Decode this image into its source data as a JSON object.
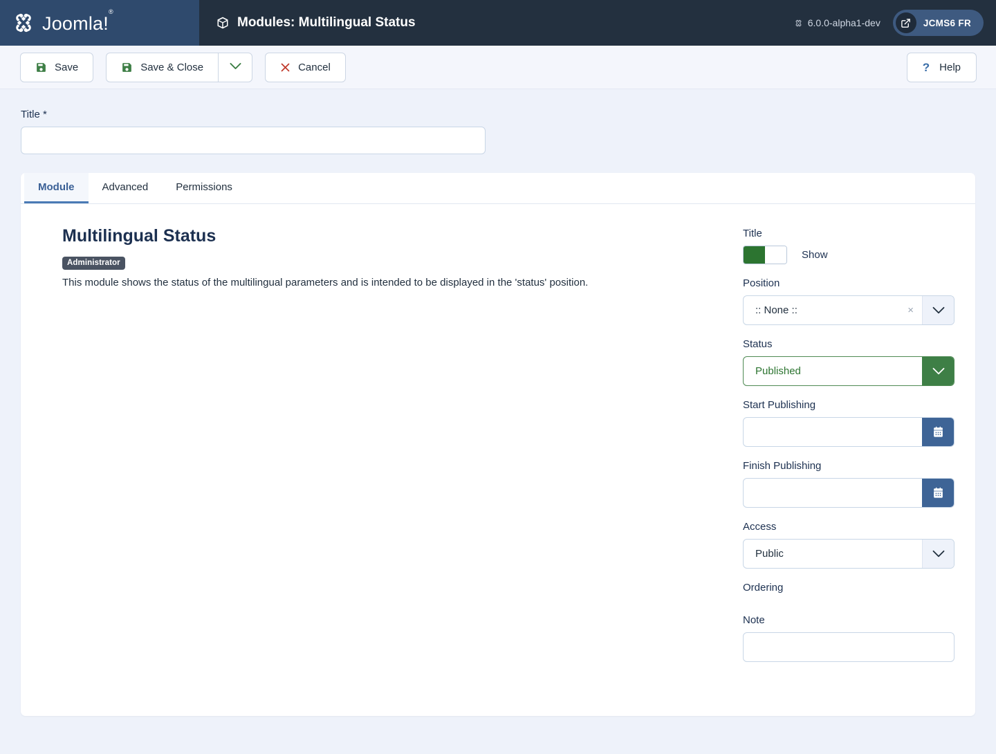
{
  "header": {
    "brand": "Joomla!",
    "brand_icon": "joomla-logo-icon",
    "title": "Modules: Multilingual Status",
    "title_icon": "cube-icon",
    "version": "6.0.0-alpha1-dev",
    "version_icon": "joomla-mark-icon",
    "site_button": "JCMS6 FR",
    "site_button_icon": "external-link-icon"
  },
  "toolbar": {
    "save_label": "Save",
    "save_icon": "floppy-disk-icon",
    "save_close_label": "Save & Close",
    "save_close_icon": "floppy-disk-icon",
    "save_dropdown_icon": "chevron-down-icon",
    "cancel_label": "Cancel",
    "cancel_icon": "close-x-icon",
    "help_label": "Help",
    "help_icon": "question-mark-icon"
  },
  "title_field": {
    "label": "Title *",
    "value": "",
    "placeholder": ""
  },
  "tabs": [
    {
      "label": "Module",
      "active": true
    },
    {
      "label": "Advanced",
      "active": false
    },
    {
      "label": "Permissions",
      "active": false
    }
  ],
  "module": {
    "heading": "Multilingual Status",
    "badge": "Administrator",
    "description": "This module shows the status of the multilingual parameters and is intended to be displayed in the 'status' position."
  },
  "sidebar": {
    "title": {
      "label": "Title",
      "toggle_state": "Show",
      "toggle_on": true
    },
    "position": {
      "label": "Position",
      "value": ":: None ::",
      "clear_icon": "close-x-icon",
      "caret_icon": "chevron-down-icon"
    },
    "status": {
      "label": "Status",
      "value": "Published",
      "caret_icon": "chevron-down-icon"
    },
    "start_publishing": {
      "label": "Start Publishing",
      "value": "",
      "calendar_icon": "calendar-icon"
    },
    "finish_publishing": {
      "label": "Finish Publishing",
      "value": "",
      "calendar_icon": "calendar-icon"
    },
    "access": {
      "label": "Access",
      "value": "Public",
      "caret_icon": "chevron-down-icon"
    },
    "ordering": {
      "label": "Ordering"
    },
    "note": {
      "label": "Note",
      "value": "",
      "placeholder": ""
    }
  },
  "colors": {
    "header_bg": "#23303f",
    "logo_bg": "#2f4a6d",
    "page_bg": "#eef2fa",
    "accent_blue": "#4a7ab5",
    "green": "#2c7430",
    "red": "#c0392b",
    "calendar_blue": "#3e6496"
  }
}
